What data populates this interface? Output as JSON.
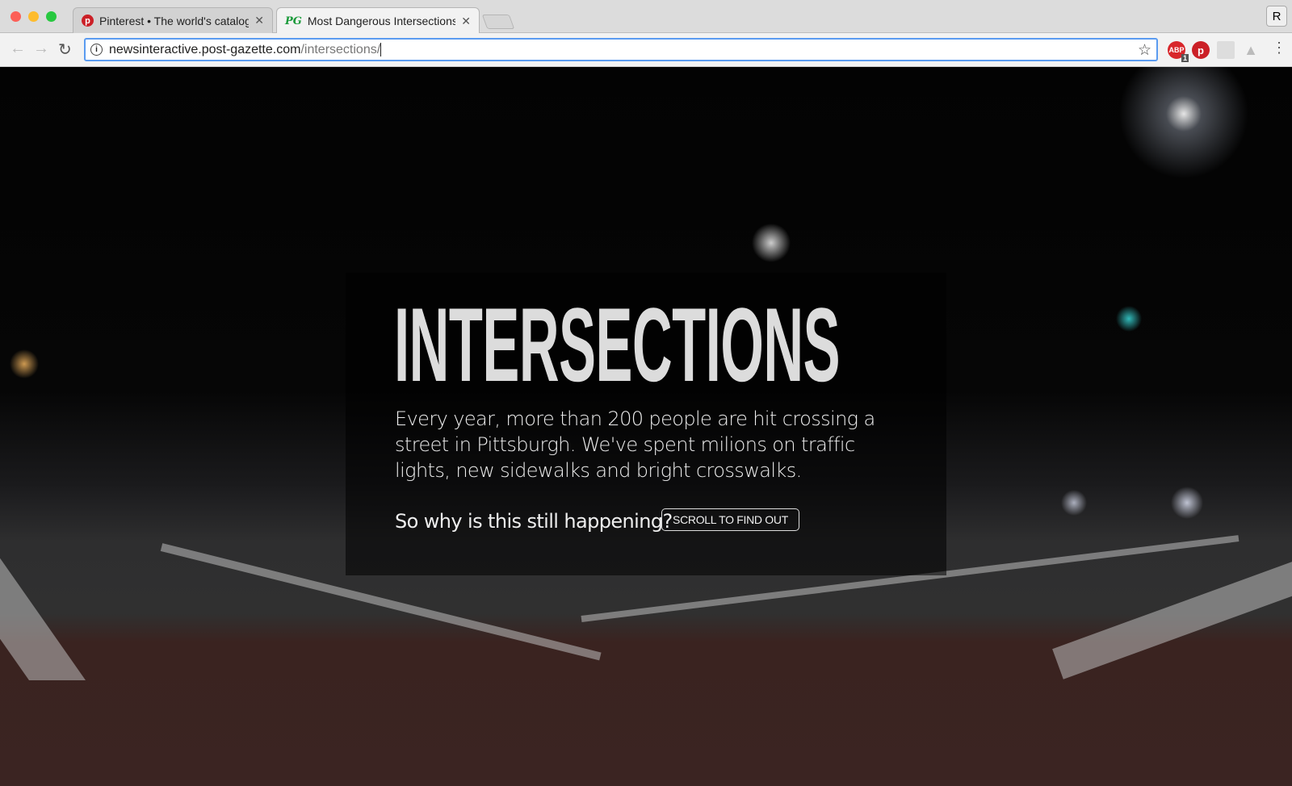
{
  "browser": {
    "tabs": [
      {
        "title": "Pinterest • The world's catalog of ideas",
        "active": false
      },
      {
        "title": "Most Dangerous Intersections",
        "active": true
      }
    ],
    "profile_initial": "R",
    "url_host": "newsinteractive.post-gazette.com",
    "url_path": "/intersections/",
    "extensions": [
      {
        "name": "adblock-plus",
        "label": "ABP",
        "badge": "1"
      },
      {
        "name": "pinterest"
      },
      {
        "name": "clipboard"
      },
      {
        "name": "google-drive"
      }
    ]
  },
  "hero": {
    "title": "INTERSECTIONS",
    "lede": "Every year, more than 200 people are hit crossing a street in Pittsburgh. We've spent milions on traffic lights, new sidewalks and bright crosswalks.",
    "question": "So why is this still happening?",
    "cta": "SCROLL TO FIND OUT"
  }
}
